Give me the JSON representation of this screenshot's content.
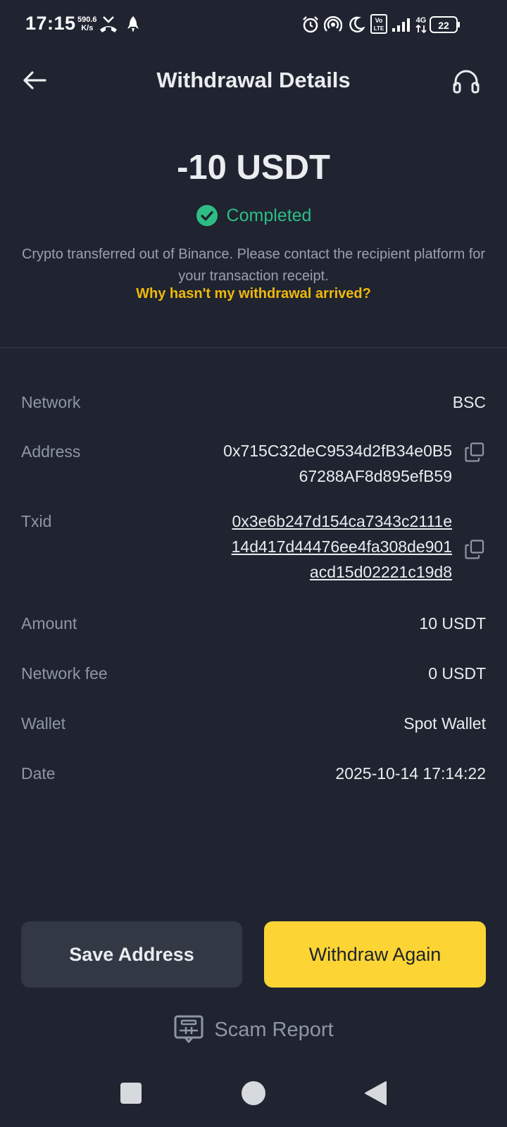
{
  "status_bar": {
    "time": "17:15",
    "net_speed_value": "590.6",
    "net_speed_unit": "K/s",
    "battery": "22",
    "volte_label": "Vo LTE",
    "network_type": "4G"
  },
  "header": {
    "title": "Withdrawal Details"
  },
  "summary": {
    "amount": "-10 USDT",
    "status": "Completed",
    "notice": "Crypto transferred out of Binance. Please contact the recipient platform for your transaction receipt.",
    "help_link": "Why hasn't my withdrawal arrived?"
  },
  "details": {
    "network_label": "Network",
    "network_value": "BSC",
    "address_label": "Address",
    "address_line1": "0x715C32deC9534d2fB34e0B5",
    "address_line2": "67288AF8d895efB59",
    "txid_label": "Txid",
    "txid_line1": "0x3e6b247d154ca7343c2111e",
    "txid_line2": "14d417d44476ee4fa308de901",
    "txid_line3": "acd15d02221c19d8",
    "amount_label": "Amount",
    "amount_value": "10 USDT",
    "fee_label": "Network fee",
    "fee_value": "0 USDT",
    "wallet_label": "Wallet",
    "wallet_value": "Spot Wallet",
    "date_label": "Date",
    "date_value": "2025-10-14 17:14:22"
  },
  "actions": {
    "save_label": "Save Address",
    "withdraw_label": "Withdraw Again",
    "scam_label": "Scam Report"
  },
  "colors": {
    "background": "#1f2430",
    "success": "#2ebd85",
    "accent": "#f0b90b",
    "primary_button": "#fcd535",
    "secondary_button": "#323844"
  },
  "icons": {
    "back": "arrow-left-icon",
    "support": "headset-icon",
    "status": "check-circle-icon",
    "copy": "copy-icon",
    "scam": "report-icon"
  }
}
